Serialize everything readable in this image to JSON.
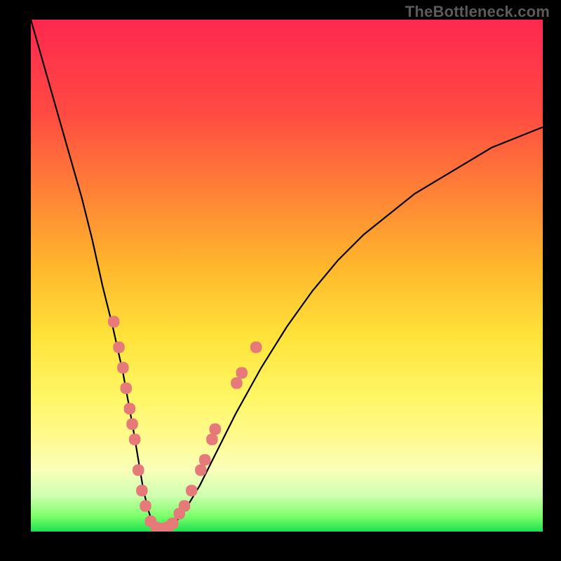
{
  "credit_text": "TheBottleneck.com",
  "colors": {
    "background": "#000000",
    "curve": "#000000",
    "markers": "#e67a78"
  },
  "chart_data": {
    "type": "line",
    "title": "",
    "xlabel": "",
    "ylabel": "",
    "xlim": [
      0,
      100
    ],
    "ylim": [
      0,
      100
    ],
    "series": [
      {
        "name": "bottleneck-curve",
        "x": [
          0,
          2,
          4,
          6,
          8,
          10,
          12,
          14,
          16,
          18,
          20,
          21,
          22,
          23,
          24,
          25,
          26.5,
          28,
          30,
          33,
          36,
          40,
          45,
          50,
          55,
          60,
          65,
          70,
          75,
          80,
          85,
          90,
          95,
          100
        ],
        "y": [
          100,
          93,
          86,
          79,
          72,
          65,
          57,
          48,
          40,
          31,
          20,
          14,
          8,
          4,
          1,
          0.5,
          0.5,
          1.5,
          4,
          9,
          15,
          23,
          32,
          40,
          47,
          53,
          58,
          62,
          66,
          69,
          72,
          75,
          77,
          79
        ]
      }
    ],
    "markers": {
      "name": "highlight-dots",
      "points": [
        {
          "x": 16.2,
          "y": 41
        },
        {
          "x": 17.2,
          "y": 36
        },
        {
          "x": 18.0,
          "y": 32
        },
        {
          "x": 18.6,
          "y": 28
        },
        {
          "x": 19.3,
          "y": 24
        },
        {
          "x": 19.8,
          "y": 21
        },
        {
          "x": 20.3,
          "y": 18
        },
        {
          "x": 21.0,
          "y": 12
        },
        {
          "x": 21.7,
          "y": 8
        },
        {
          "x": 22.4,
          "y": 5
        },
        {
          "x": 23.4,
          "y": 2
        },
        {
          "x": 24.5,
          "y": 0.8
        },
        {
          "x": 25.6,
          "y": 0.6
        },
        {
          "x": 26.8,
          "y": 0.9
        },
        {
          "x": 27.7,
          "y": 1.6
        },
        {
          "x": 29.0,
          "y": 3.5
        },
        {
          "x": 30.0,
          "y": 5
        },
        {
          "x": 31.4,
          "y": 8
        },
        {
          "x": 33.2,
          "y": 12
        },
        {
          "x": 34.0,
          "y": 14
        },
        {
          "x": 35.4,
          "y": 18
        },
        {
          "x": 36.0,
          "y": 20
        },
        {
          "x": 40.2,
          "y": 29
        },
        {
          "x": 41.2,
          "y": 31
        },
        {
          "x": 44.0,
          "y": 36
        }
      ]
    }
  }
}
